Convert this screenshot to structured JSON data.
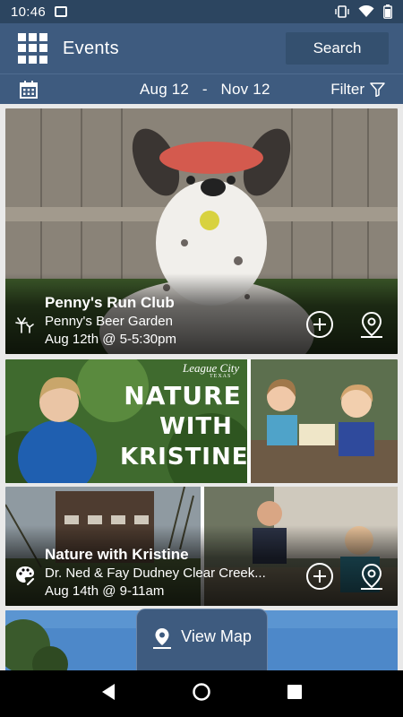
{
  "status": {
    "time": "10:46",
    "icons": [
      "gallery-icon",
      "vibrate-icon",
      "wifi-icon",
      "battery-icon"
    ]
  },
  "header": {
    "title": "Events",
    "search_label": "Search",
    "menu_icon": "grid-icon"
  },
  "filter_bar": {
    "date_from": "Aug 12",
    "date_sep": "-",
    "date_to": "Nov 12",
    "filter_label": "Filter"
  },
  "events": [
    {
      "title": "Penny's Run Club",
      "location": "Penny's Beer Garden",
      "when": "Aug 12th @ 5-5:30pm",
      "category_icon": "fireworks-icon"
    },
    {
      "banner_brand": "League City",
      "banner_state": "TEXAS",
      "banner_line1": "NATURE",
      "banner_line2": "WITH",
      "banner_line3": "KRISTINE"
    },
    {
      "title": "Nature with Kristine",
      "location": "Dr. Ned & Fay Dudney Clear Creek...",
      "when": "Aug 14th @ 9-11am",
      "category_icon": "palette-icon"
    }
  ],
  "view_map": {
    "label": "View Map"
  },
  "colors": {
    "brand": "#3e5b7f",
    "status_bar": "#2c4560",
    "nav_bar": "#000000"
  }
}
